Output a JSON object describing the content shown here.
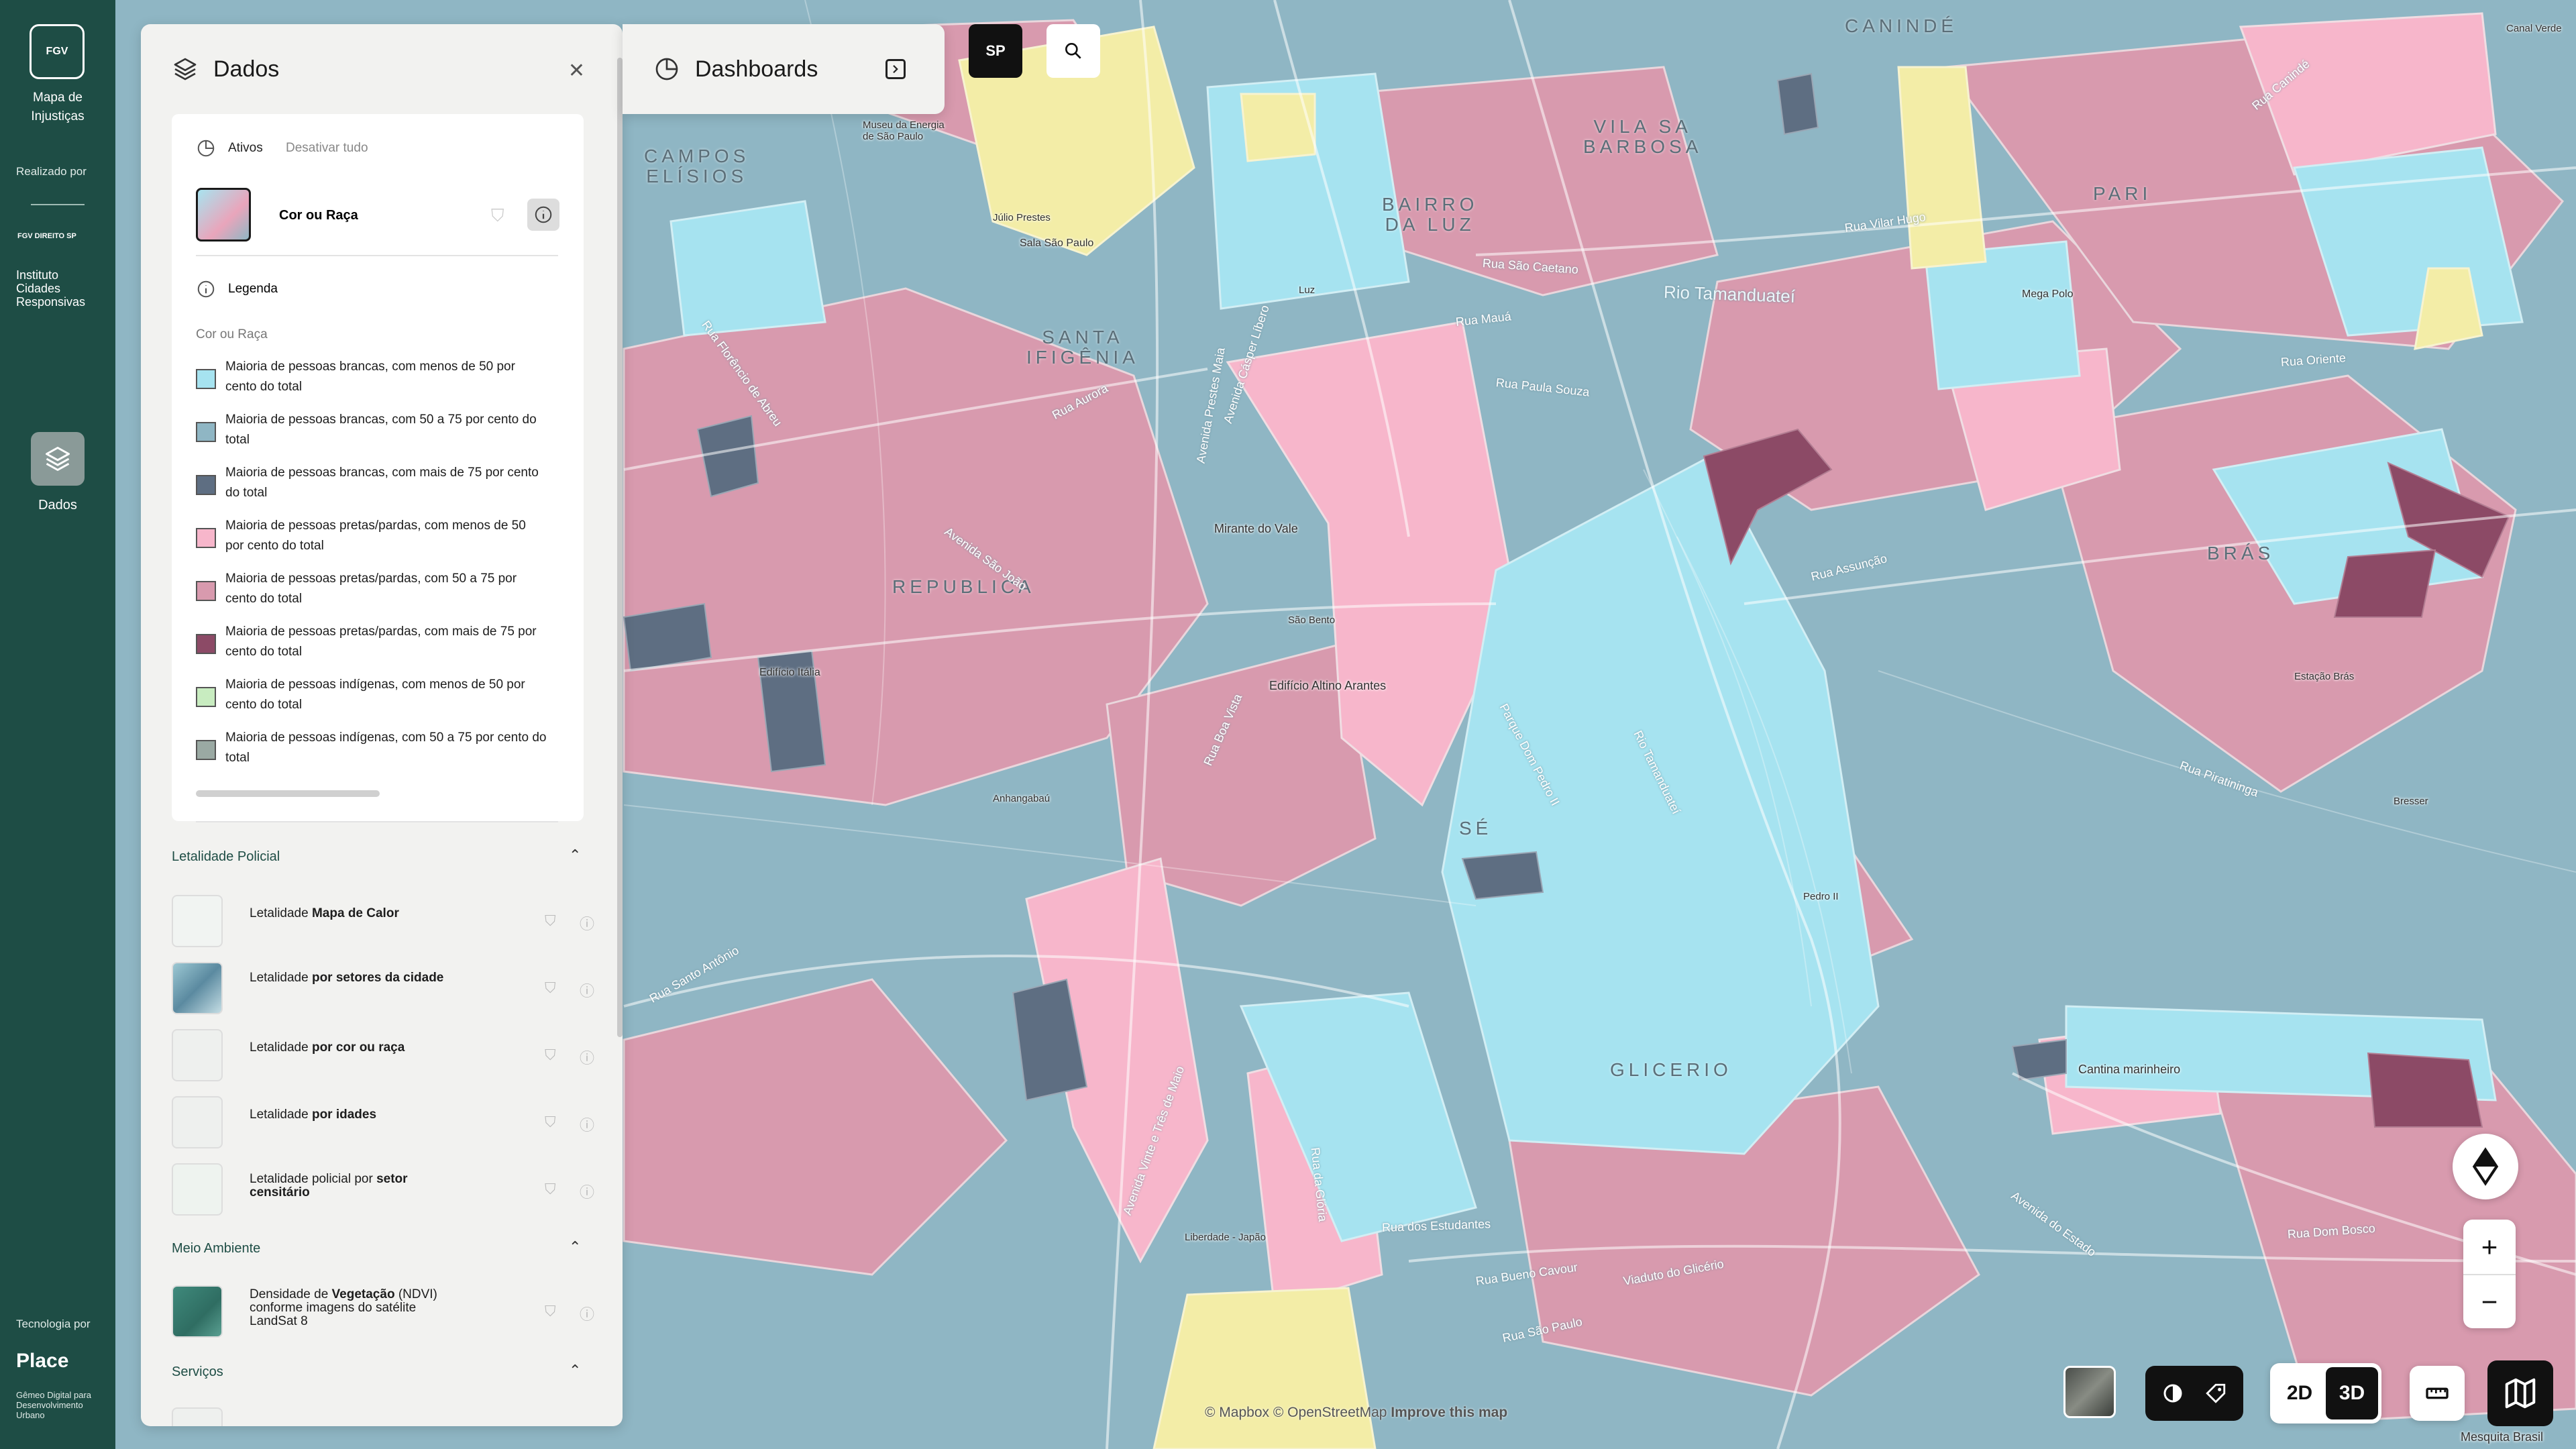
{
  "nav": {
    "logo_text": "FGV",
    "app_title": "Mapa de\nInjustiças",
    "realizado_por": "Realizado por",
    "partner_logo": "FGV DIREITO SP",
    "institute": "Instituto\nCidades\nResponsivas",
    "dados_label": "Dados",
    "tecnologia_por": "Tecnologia por",
    "place": "Place",
    "place_sub": "Gêmeo Digital para\nDesenvolvimento\nUrbano"
  },
  "panel": {
    "title": "Dados",
    "active_label": "Ativos",
    "deactivate_all": "Desativar tudo",
    "active_layer": "Cor ou Raça",
    "legend_label": "Legenda",
    "legend_subtitle": "Cor ou Raça",
    "legend": [
      {
        "color": "#a6e3f0",
        "text": "Maioria de pessoas brancas, com menos de 50 por cento do total"
      },
      {
        "color": "#8fb6c4",
        "text": "Maioria de pessoas brancas, com 50 a 75 por cento do total"
      },
      {
        "color": "#5e6e82",
        "text": "Maioria de pessoas brancas, com mais de 75 por cento do total"
      },
      {
        "color": "#f7b6cb",
        "text": "Maioria de pessoas pretas/pardas, com menos de 50 por cento do total"
      },
      {
        "color": "#d89aae",
        "text": "Maioria de pessoas pretas/pardas, com 50 a 75 por cento do total"
      },
      {
        "color": "#8c4a66",
        "text": "Maioria de pessoas pretas/pardas, com mais de 75 por cento do total"
      },
      {
        "color": "#c8ecc0",
        "text": "Maioria de pessoas indígenas, com menos de 50 por cento do total"
      },
      {
        "color": "#9aa9a3",
        "text": "Maioria de pessoas indígenas, com 50 a 75 por cento do total"
      }
    ],
    "sections": [
      {
        "title": "Letalidade Policial",
        "items": [
          {
            "prefix": "Letalidade ",
            "bold": "Mapa de Calor"
          },
          {
            "prefix": "Letalidade ",
            "bold": "por setores da cidade"
          },
          {
            "prefix": "Letalidade ",
            "bold": "por cor ou raça"
          },
          {
            "prefix": "Letalidade ",
            "bold": "por idades"
          },
          {
            "prefix": "Letalidade policial por ",
            "bold": "setor censitário"
          }
        ]
      },
      {
        "title": "Meio Ambiente",
        "items": [
          {
            "prefix": "Densidade de ",
            "bold": "Vegetação",
            "suffix": " (NDVI) conforme imagens do satélite LandSat 8"
          }
        ]
      },
      {
        "title": "Serviços",
        "items": []
      }
    ]
  },
  "dashboards": {
    "title": "Dashboards"
  },
  "top": {
    "sp_label": "SP"
  },
  "controls": {
    "zoom_in": "+",
    "zoom_out": "−",
    "mode_2d": "2D",
    "mode_3d": "3D"
  },
  "attribution": {
    "mapbox": "© Mapbox",
    "osm": "© OpenStreetMap",
    "improve": "Improve this map"
  },
  "map_labels": {
    "districts": [
      "CAMPOS\nELÍSIOS",
      "SANTA\nIFIGÊNIA",
      "BAIRRO\nDA LUZ",
      "VILA SA\nBARBOSA",
      "CANINDÉ",
      "PARI",
      "BRÁS",
      "REPUBLICA",
      "SÉ",
      "GLICERIO"
    ],
    "streets": [
      "Rua Mauá",
      "Rua São Caetano",
      "Rua Paula Souza",
      "Rua Aurora",
      "Avenida São João",
      "Rua Boa Vista",
      "Avenida Prestes Maia",
      "Rua Santo Antônio",
      "Rua Assunção",
      "Rua Oriente",
      "Rua Vilar Hugo",
      "Avenida Vinte e Três de Maio",
      "Rua da Glória",
      "Rua dos Estudantes",
      "Rua Bueno Cavour",
      "Viaduto do Glicério",
      "Rua São Paulo",
      "Avenida do Estado",
      "Rua Dom Bosco",
      "Rio Tamanduateí",
      "Parque Dom Pedro II",
      "Rua Florêncio de Abreu",
      "Avenida Cásper Líbero",
      "Rua Piratininga",
      "Rua Canindé"
    ],
    "pois": [
      "Museu da Energia\nde São Paulo",
      "Júlio Prestes",
      "Sala São Paulo",
      "Mirante do Vale",
      "Edifício Altino Arantes",
      "Edifício Itália",
      "Anhangabaú",
      "São Bento",
      "Mega Polo",
      "Cantina marinheiro",
      "Liberdade - Japão",
      "Mesquita Brasil",
      "Canal Verde",
      "Pedro II",
      "Estação Brás",
      "Bresser",
      "Luz"
    ]
  }
}
